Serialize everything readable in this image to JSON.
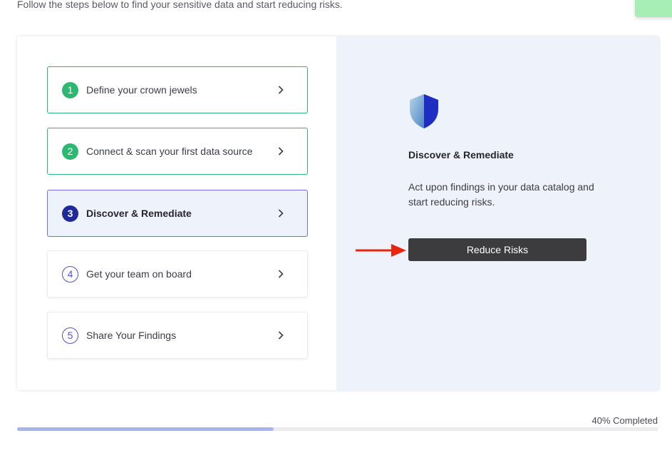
{
  "header": {
    "subtitle": "Follow the steps below to find your sensitive data and start reducing risks."
  },
  "steps": [
    {
      "number": "1",
      "label": "Define your crown jewels",
      "state": "completed"
    },
    {
      "number": "2",
      "label": "Connect & scan your first data source",
      "state": "completed"
    },
    {
      "number": "3",
      "label": "Discover & Remediate",
      "state": "active"
    },
    {
      "number": "4",
      "label": "Get your team on board",
      "state": "pending"
    },
    {
      "number": "5",
      "label": "Share Your Findings",
      "state": "pending"
    }
  ],
  "detail": {
    "icon": "shield-icon",
    "title": "Discover & Remediate",
    "description": "Act upon findings in your data catalog and start reducing risks.",
    "button_label": "Reduce Risks"
  },
  "progress": {
    "label": "40% Completed",
    "percent": 40
  },
  "colors": {
    "completed": "#2db872",
    "active": "#1e2a9c",
    "pending": "#4d56c8",
    "button": "#3c3c3f",
    "annotation_arrow": "#e8260e",
    "progress_fill": "#a9b4ea"
  }
}
